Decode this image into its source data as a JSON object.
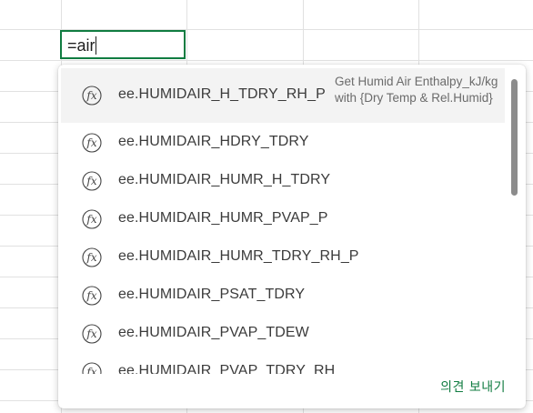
{
  "cell": {
    "formula_text": "=air"
  },
  "autocomplete": {
    "items": [
      {
        "name": "ee.HUMIDAIR_H_TDRY_RH_P",
        "description": "Get Humid Air Enthalpy_kJ/kg with {Dry Temp & Rel.Humid}",
        "selected": true
      },
      {
        "name": "ee.HUMIDAIR_HDRY_TDRY"
      },
      {
        "name": "ee.HUMIDAIR_HUMR_H_TDRY"
      },
      {
        "name": "ee.HUMIDAIR_HUMR_PVAP_P"
      },
      {
        "name": "ee.HUMIDAIR_HUMR_TDRY_RH_P"
      },
      {
        "name": "ee.HUMIDAIR_PSAT_TDRY"
      },
      {
        "name": "ee.HUMIDAIR_PVAP_TDEW"
      },
      {
        "name": "ee.HUMIDAIR_PVAP_TDRY_RH"
      }
    ],
    "feedback_label": "의견 보내기",
    "icon": "function-fx-icon"
  },
  "colors": {
    "accent": "#107c41",
    "selected_row": "#f3f3f3",
    "grid": "#e1e1e1"
  }
}
